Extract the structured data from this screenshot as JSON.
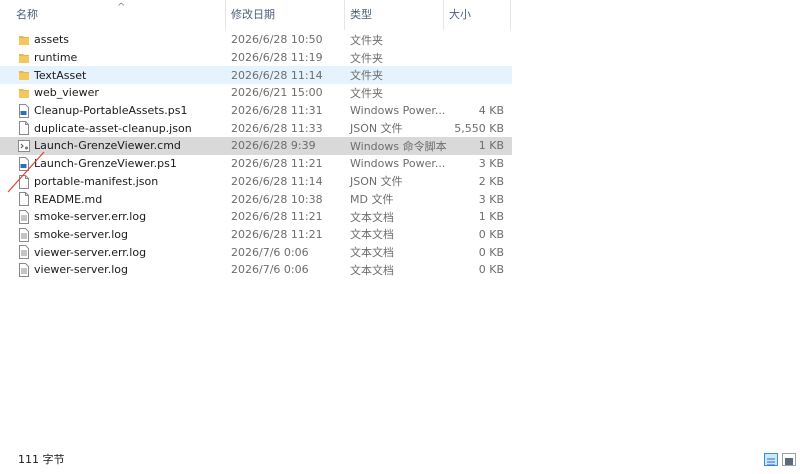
{
  "columns": {
    "name": "名称",
    "date": "修改日期",
    "type": "类型",
    "size": "大小"
  },
  "sort_indicator": "^",
  "files": [
    {
      "icon": "folder-icon",
      "name": "assets",
      "date": "2026/6/28 10:50",
      "type": "文件夹",
      "size": ""
    },
    {
      "icon": "folder-icon",
      "name": "runtime",
      "date": "2026/6/28 11:19",
      "type": "文件夹",
      "size": ""
    },
    {
      "icon": "folder-icon",
      "name": "TextAsset",
      "date": "2026/6/28 11:14",
      "type": "文件夹",
      "size": "",
      "state": "hover"
    },
    {
      "icon": "folder-icon",
      "name": "web_viewer",
      "date": "2026/6/21 15:00",
      "type": "文件夹",
      "size": ""
    },
    {
      "icon": "powershell-script-icon",
      "name": "Cleanup-PortableAssets.ps1",
      "date": "2026/6/28 11:31",
      "type": "Windows Power...",
      "size": "4 KB"
    },
    {
      "icon": "file-icon",
      "name": "duplicate-asset-cleanup.json",
      "date": "2026/6/28 11:33",
      "type": "JSON 文件",
      "size": "5,550 KB"
    },
    {
      "icon": "cmd-script-icon",
      "name": "Launch-GrenzeViewer.cmd",
      "date": "2026/6/28 9:39",
      "type": "Windows 命令脚本",
      "size": "1 KB",
      "state": "selected"
    },
    {
      "icon": "powershell-script-icon",
      "name": "Launch-GrenzeViewer.ps1",
      "date": "2026/6/28 11:21",
      "type": "Windows Power...",
      "size": "3 KB"
    },
    {
      "icon": "file-icon",
      "name": "portable-manifest.json",
      "date": "2026/6/28 11:14",
      "type": "JSON 文件",
      "size": "2 KB"
    },
    {
      "icon": "file-icon",
      "name": "README.md",
      "date": "2026/6/28 10:38",
      "type": "MD 文件",
      "size": "3 KB"
    },
    {
      "icon": "text-file-icon",
      "name": "smoke-server.err.log",
      "date": "2026/6/28 11:21",
      "type": "文本文档",
      "size": "1 KB"
    },
    {
      "icon": "text-file-icon",
      "name": "smoke-server.log",
      "date": "2026/6/28 11:21",
      "type": "文本文档",
      "size": "0 KB"
    },
    {
      "icon": "text-file-icon",
      "name": "viewer-server.err.log",
      "date": "2026/7/6 0:06",
      "type": "文本文档",
      "size": "0 KB"
    },
    {
      "icon": "text-file-icon",
      "name": "viewer-server.log",
      "date": "2026/7/6 0:06",
      "type": "文本文档",
      "size": "0 KB"
    }
  ],
  "status": {
    "text": "111 字节"
  },
  "colors": {
    "folder": "#e8b548",
    "selected": "#d9d9d9",
    "hover": "#e5f3ff",
    "annotation": "#e04030"
  }
}
